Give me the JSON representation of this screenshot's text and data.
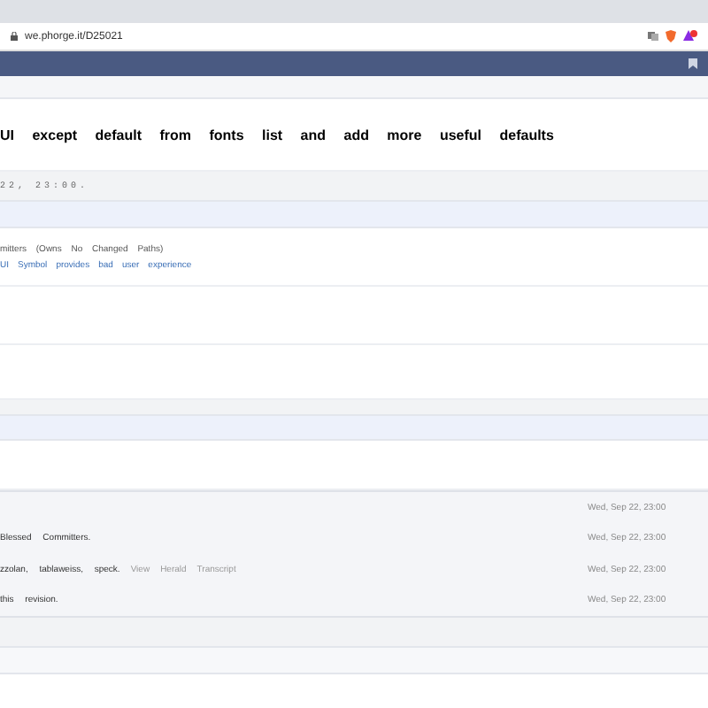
{
  "browser": {
    "url": "we.phorge.it/D25021"
  },
  "title": "UI except default from fonts list and add more useful defaults",
  "header_meta": "22, 23:00.",
  "details": {
    "line_1": "mitters (Owns No Changed Paths)",
    "links": [
      "UI",
      "Symbol",
      "provides",
      "bad",
      "user",
      "experience"
    ]
  },
  "timeline": [
    {
      "date": "Wed, Sep 22, 23:00"
    },
    {
      "text": "Blessed Committers.",
      "date": "Wed, Sep 22, 23:00"
    },
    {
      "text": "zzolan, tablaweiss, speck.",
      "actions": [
        "View",
        "Herald",
        "Transcript"
      ],
      "date": "Wed, Sep 22, 23:00"
    },
    {
      "text": "this revision.",
      "date": "Wed, Sep 22, 23:00"
    }
  ]
}
